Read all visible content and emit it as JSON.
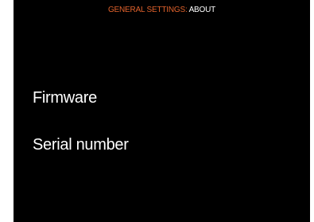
{
  "header": {
    "parent": "GENERAL SETTINGS:",
    "current": "ABOUT"
  },
  "menu": {
    "items": [
      {
        "label": "Firmware"
      },
      {
        "label": "Serial number"
      }
    ]
  },
  "colors": {
    "background": "#000000",
    "accent": "#e0622c",
    "text": "#ffffff"
  }
}
